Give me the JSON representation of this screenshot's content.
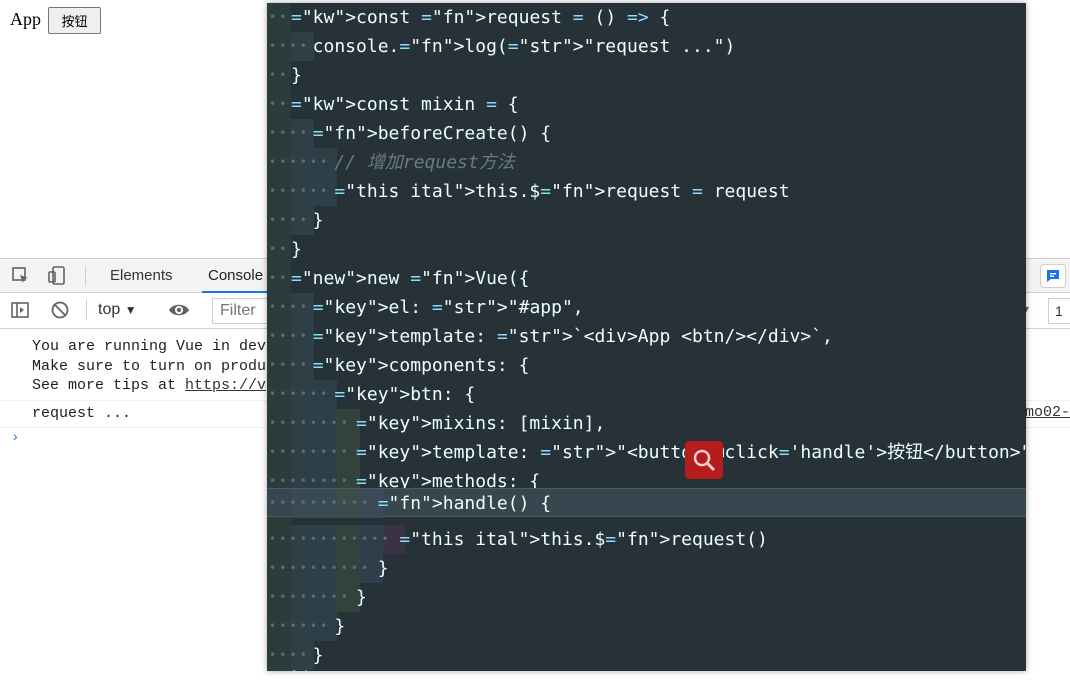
{
  "app": {
    "label": "App",
    "button_label": "按钮"
  },
  "devtools": {
    "tabs": [
      "Elements",
      "Console"
    ],
    "context_select": "top",
    "filter_placeholder": "Filter",
    "right_selector_value": "1",
    "console": {
      "vue_warning_lines": [
        "You are running Vue in dev",
        "Make sure to turn on produ",
        "See more tips at "
      ],
      "vue_warning_link": "https://v",
      "log_message": "request ...",
      "log_source": "mo02-",
      "prompt": "›"
    }
  },
  "code": {
    "lines": [
      "const request = () => {",
      "  console.log(\"request ...\")",
      "}",
      "const mixin = {",
      "  beforeCreate() {",
      "    // 增加request方法",
      "    this.$request = request",
      "  }",
      "}",
      "new Vue({",
      "  el: \"#app\",",
      "  template: `<div>App <btn/></div>`,",
      "  components: {",
      "    btn: {",
      "      mixins: [mixin],",
      "      template: \"<button @click='handle'>按钮</button>\",",
      "      methods: {",
      "        handle() {",
      "          this.$request()",
      "        }",
      "      }",
      "    }",
      "  }",
      "})"
    ]
  },
  "colors": {
    "editor_background": "#263238",
    "devtools_accent": "#1a73e8",
    "search_badge": "#b71c1c"
  }
}
